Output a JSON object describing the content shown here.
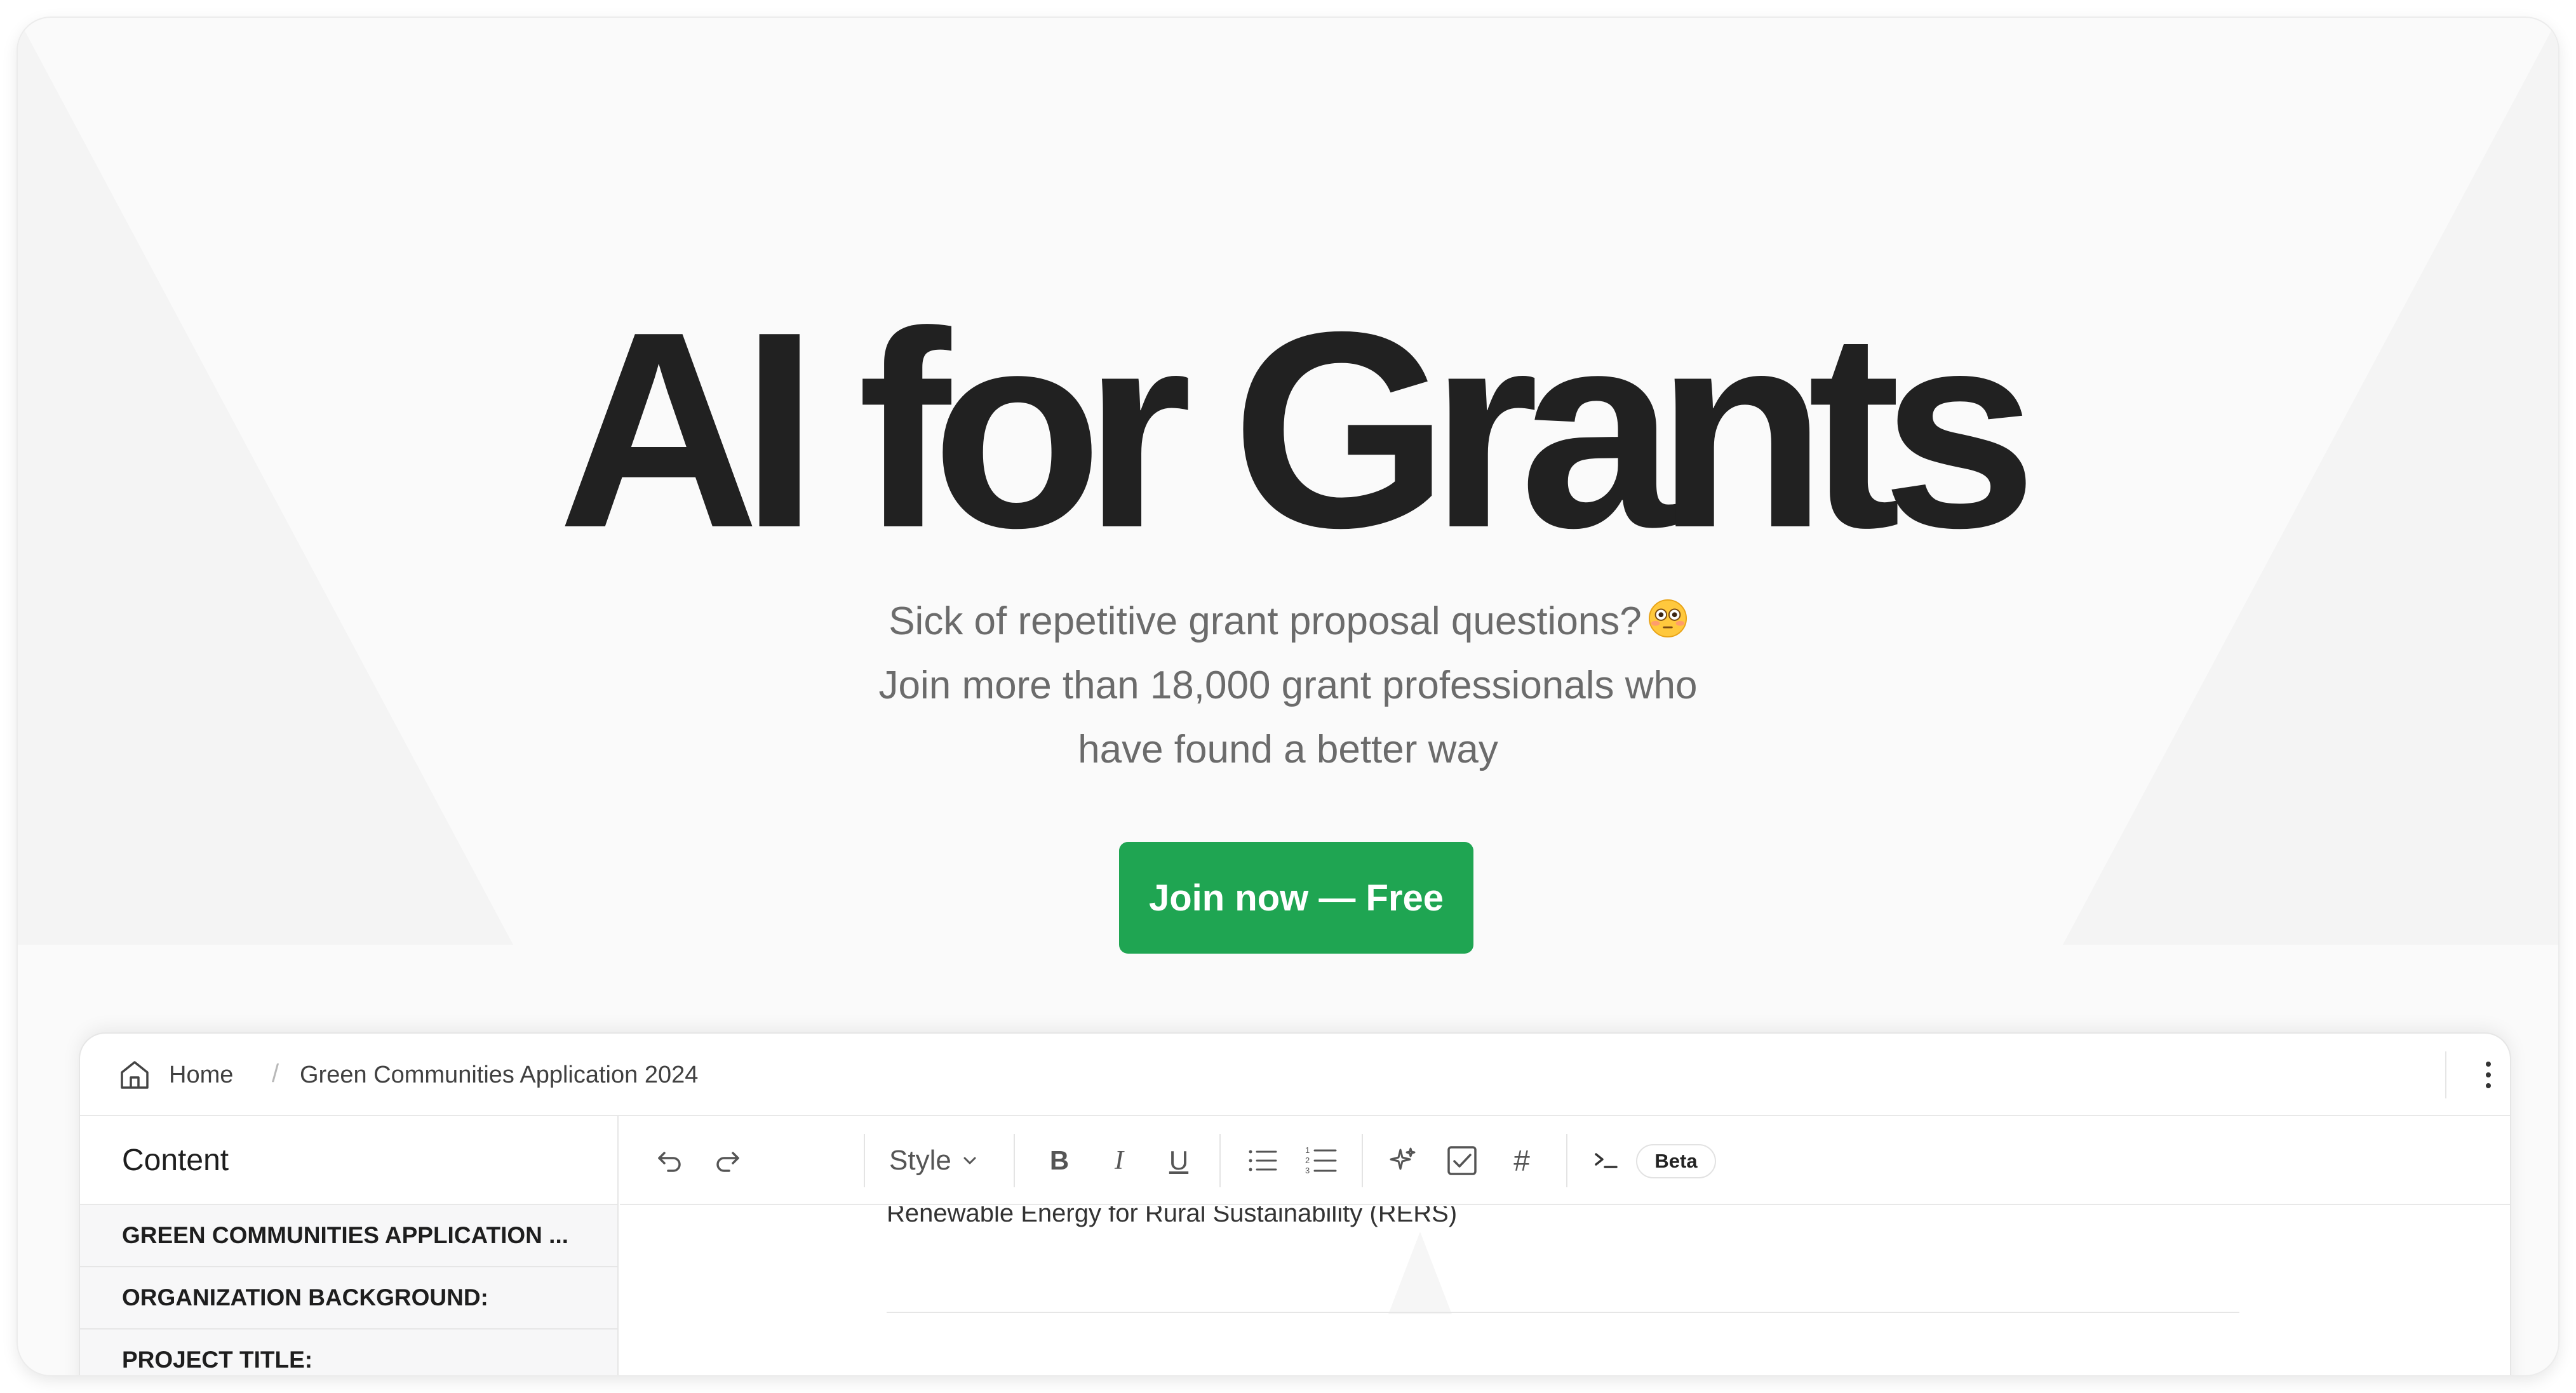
{
  "hero": {
    "title": "AI for Grants",
    "subtitle_line1": "Sick of repetitive grant proposal questions?",
    "subtitle_line2": "Join more than 18,000 grant professionals who",
    "subtitle_line3": "have found a better way",
    "emoji_icon": "flushed-face-icon",
    "cta_label": "Join now — Free",
    "cta_color": "#1fa552"
  },
  "editor": {
    "breadcrumb": {
      "home": "Home",
      "separator": "/",
      "document": "Green Communities Application 2024"
    },
    "sidebar": {
      "header": "Content",
      "items": [
        "GREEN COMMUNITIES APPLICATION ...",
        "ORGANIZATION BACKGROUND:",
        "PROJECT TITLE:"
      ]
    },
    "toolbar": {
      "style_label": "Style",
      "beta_label": "Beta",
      "icons": [
        "undo-icon",
        "redo-icon",
        "chevron-down-icon",
        "bold-icon",
        "italic-icon",
        "underline-icon",
        "bulleted-list-icon",
        "numbered-list-icon",
        "sparkle-icon",
        "checkbox-icon",
        "hash-icon",
        "terminal-icon"
      ]
    },
    "content": {
      "visible_line": "Renewable Energy for Rural Sustainability (RERS)"
    }
  }
}
